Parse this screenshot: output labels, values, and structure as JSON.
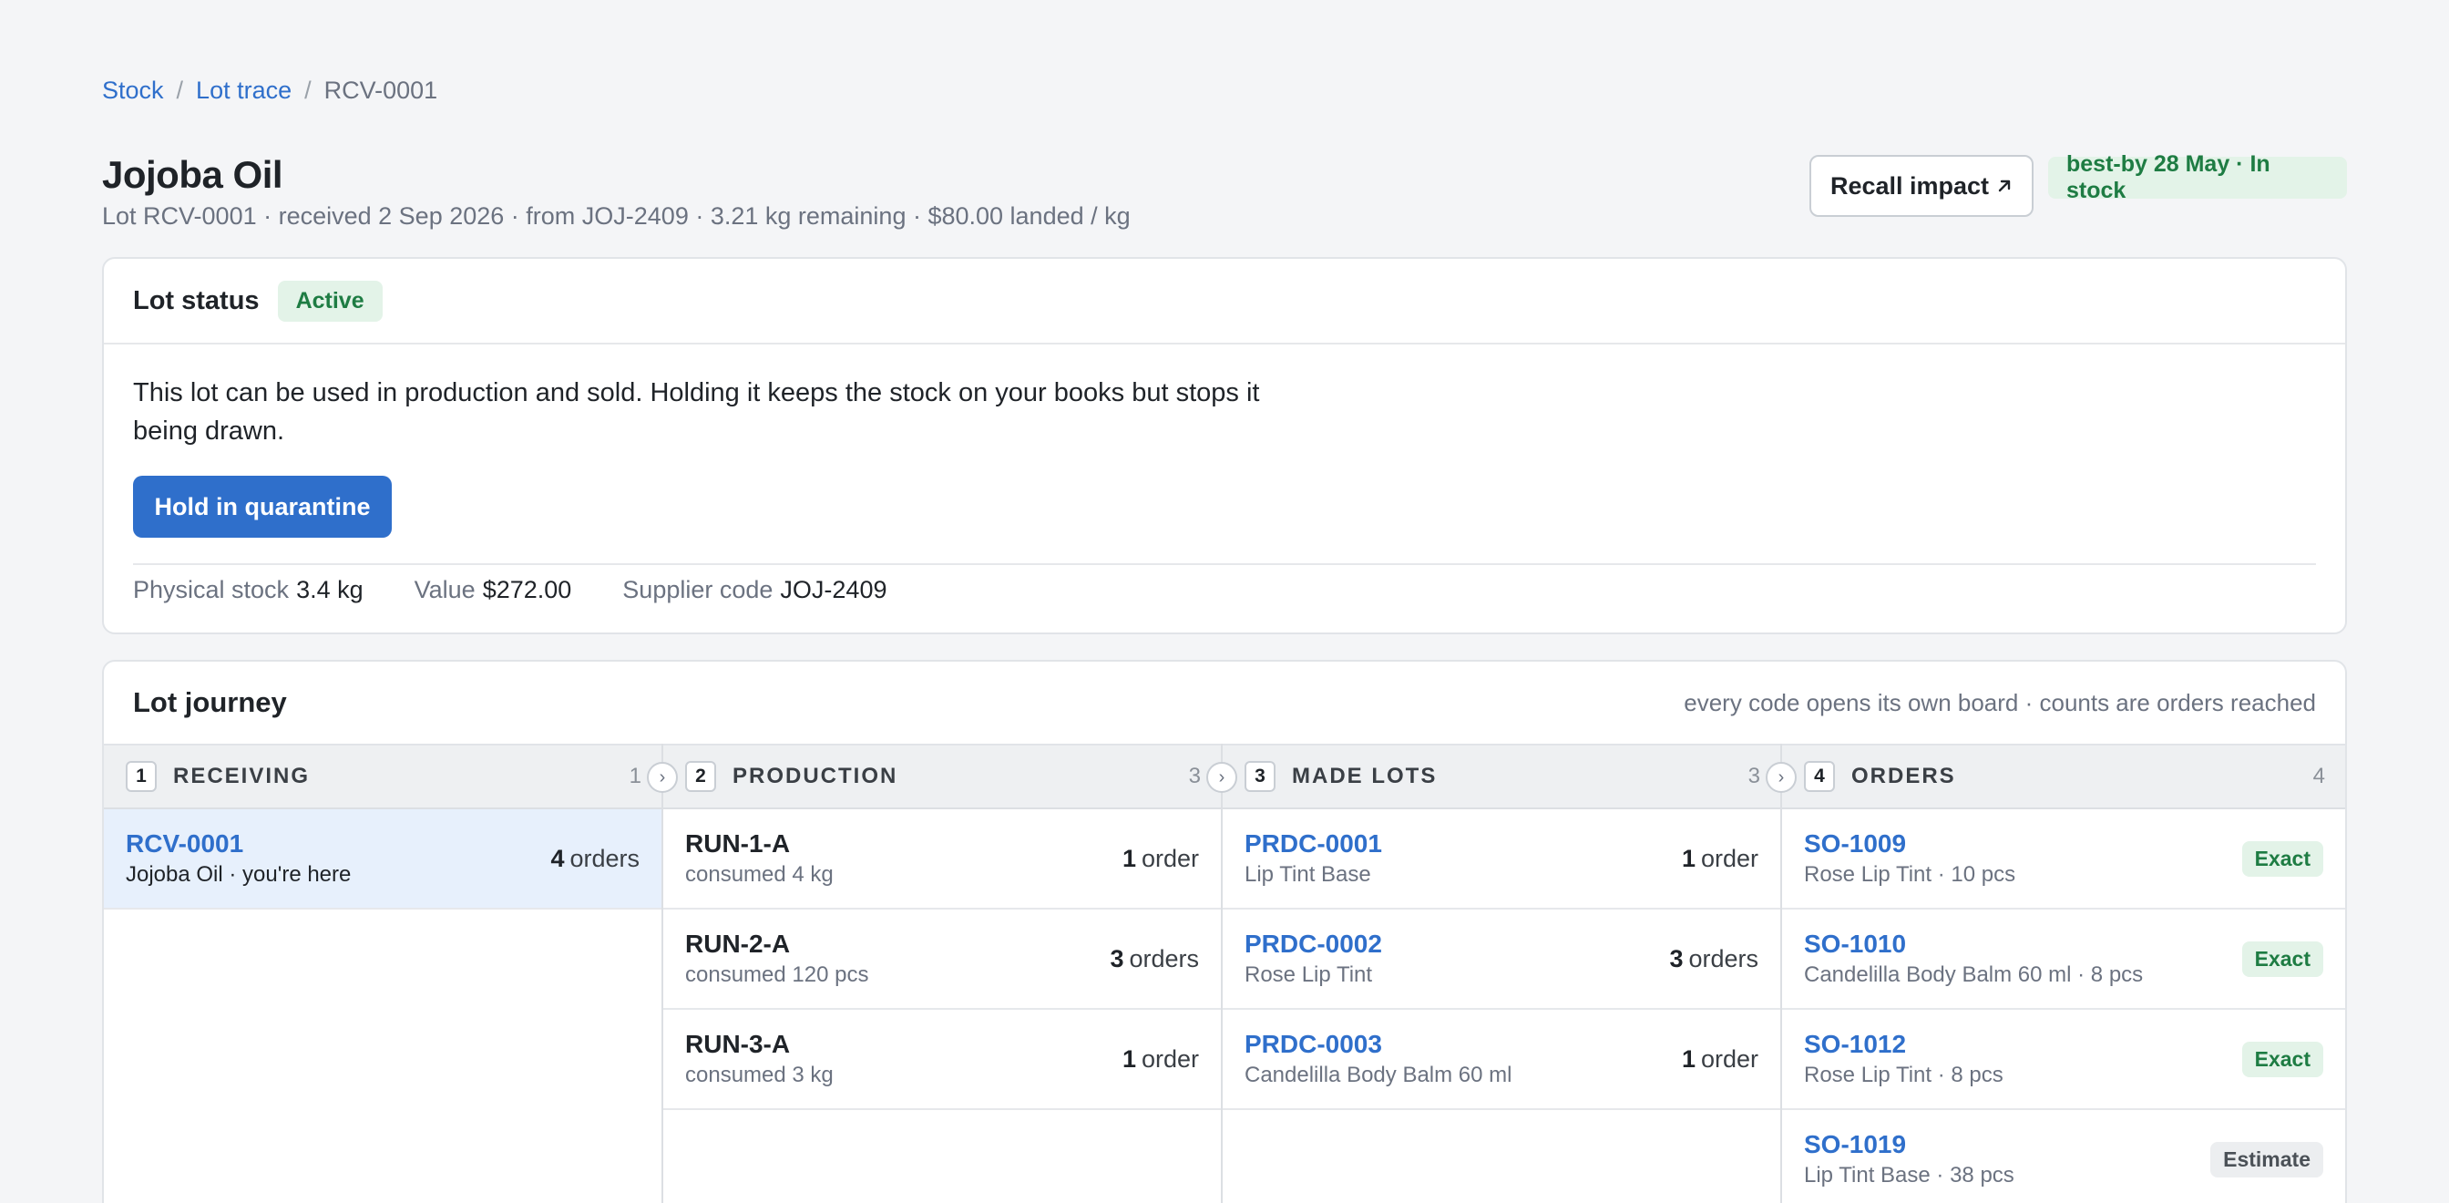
{
  "breadcrumb": {
    "stock": "Stock",
    "lot_trace": "Lot trace",
    "current": "RCV-0001",
    "sep": "/"
  },
  "header": {
    "title": "Jojoba Oil",
    "subtitle": "Lot RCV-0001 · received 2 Sep 2026 · from JOJ-2409 · 3.21 kg remaining · $80.00 landed / kg",
    "recall_label": "Recall impact",
    "recall_icon": "arrow-up-right-icon",
    "stock_badge": "best-by 28 May · In stock"
  },
  "status": {
    "label": "Lot status",
    "badge": "Active",
    "description": "This lot can be used in production and sold. Holding it keeps the stock on your books but stops it being drawn.",
    "hold_label": "Hold in quarantine",
    "facts": [
      {
        "k": "Physical stock",
        "v": "3.4 kg"
      },
      {
        "k": "Value",
        "v": "$272.00"
      },
      {
        "k": "Supplier code",
        "v": "JOJ-2409"
      }
    ]
  },
  "journey": {
    "label": "Lot journey",
    "hint": "every code opens its own board · counts are orders reached",
    "stages": [
      {
        "num": "1",
        "name": "RECEIVING",
        "count": "1",
        "nodes": [
          {
            "code": "RCV-0001",
            "sub": "Jojoba Oil · you're here",
            "n": "4",
            "unit": "orders"
          }
        ]
      },
      {
        "num": "2",
        "name": "PRODUCTION",
        "count": "3",
        "nodes": [
          {
            "code": "RUN-1-A",
            "sub": "consumed 4 kg",
            "n": "1",
            "unit": "order"
          },
          {
            "code": "RUN-2-A",
            "sub": "consumed 120 pcs",
            "n": "3",
            "unit": "orders"
          },
          {
            "code": "RUN-3-A",
            "sub": "consumed 3 kg",
            "n": "1",
            "unit": "order"
          }
        ]
      },
      {
        "num": "3",
        "name": "MADE LOTS",
        "count": "3",
        "nodes": [
          {
            "code": "PRDC-0001",
            "sub": "Lip Tint Base",
            "n": "1",
            "unit": "order"
          },
          {
            "code": "PRDC-0002",
            "sub": "Rose Lip Tint",
            "n": "3",
            "unit": "orders"
          },
          {
            "code": "PRDC-0003",
            "sub": "Candelilla Body Balm 60 ml",
            "n": "1",
            "unit": "order"
          }
        ]
      },
      {
        "num": "4",
        "name": "ORDERS",
        "count": "4",
        "nodes": [
          {
            "code": "SO-1009",
            "sub": "Rose Lip Tint · 10 pcs",
            "tag": "Exact"
          },
          {
            "code": "SO-1010",
            "sub": "Candelilla Body Balm 60 ml · 8 pcs",
            "tag": "Exact"
          },
          {
            "code": "SO-1012",
            "sub": "Rose Lip Tint · 8 pcs",
            "tag": "Exact"
          },
          {
            "code": "SO-1019",
            "sub": "Lip Tint Base · 38 pcs",
            "tag": "Estimate"
          }
        ]
      }
    ]
  }
}
